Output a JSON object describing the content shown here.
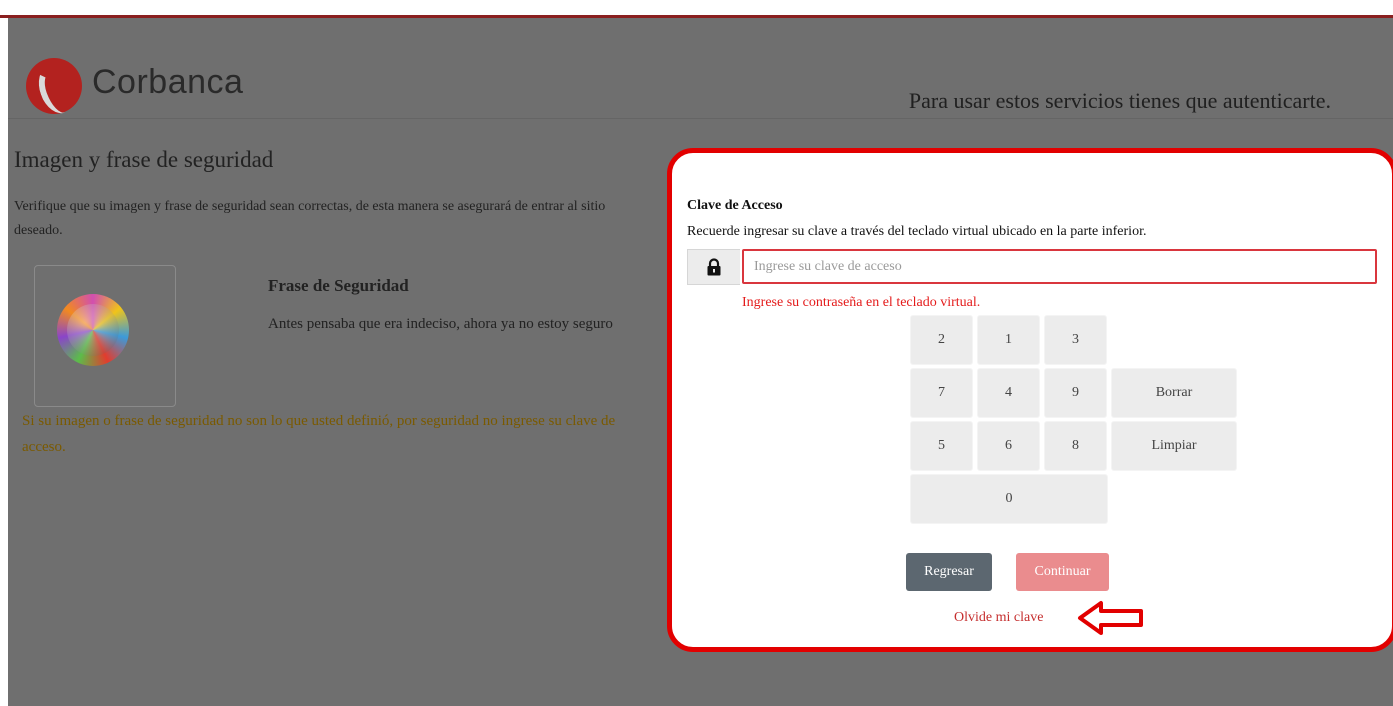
{
  "header": {
    "brand": "Corbanca",
    "auth_message": "Para usar estos servicios tienes que autenticarte."
  },
  "security": {
    "title": "Imagen y frase de seguridad",
    "description": "Verifique que su imagen y frase de seguridad sean correctas, de esta manera se asegurará de entrar al sitio deseado.",
    "image_icon": "yarn-ball-image",
    "phrase_title": "Frase de Seguridad",
    "phrase_text": "Antes pensaba que era indeciso, ahora ya no estoy seguro",
    "warning": "Si su imagen o frase de seguridad no son lo que usted definió, por seguridad no ingrese su clave de acceso."
  },
  "login": {
    "title": "Clave de Acceso",
    "instruction": "Recuerde ingresar su clave a través del teclado virtual ubicado en la parte inferior.",
    "lock_icon": "lock-icon",
    "password_placeholder": "Ingrese su clave de acceso",
    "error": "Ingrese su contraseña en el teclado virtual.",
    "keypad": {
      "keys": [
        "2",
        "1",
        "3",
        "7",
        "4",
        "9",
        "5",
        "6",
        "8",
        "0"
      ],
      "delete_label": "Borrar",
      "clear_label": "Limpiar"
    },
    "back_label": "Regresar",
    "continue_label": "Continuar",
    "forgot_label": "Olvide mi clave"
  },
  "colors": {
    "highlight_border": "#e20000",
    "overlay": "#6f6f6f",
    "error_text": "#e41b1b",
    "brand_red": "#b3221f"
  }
}
